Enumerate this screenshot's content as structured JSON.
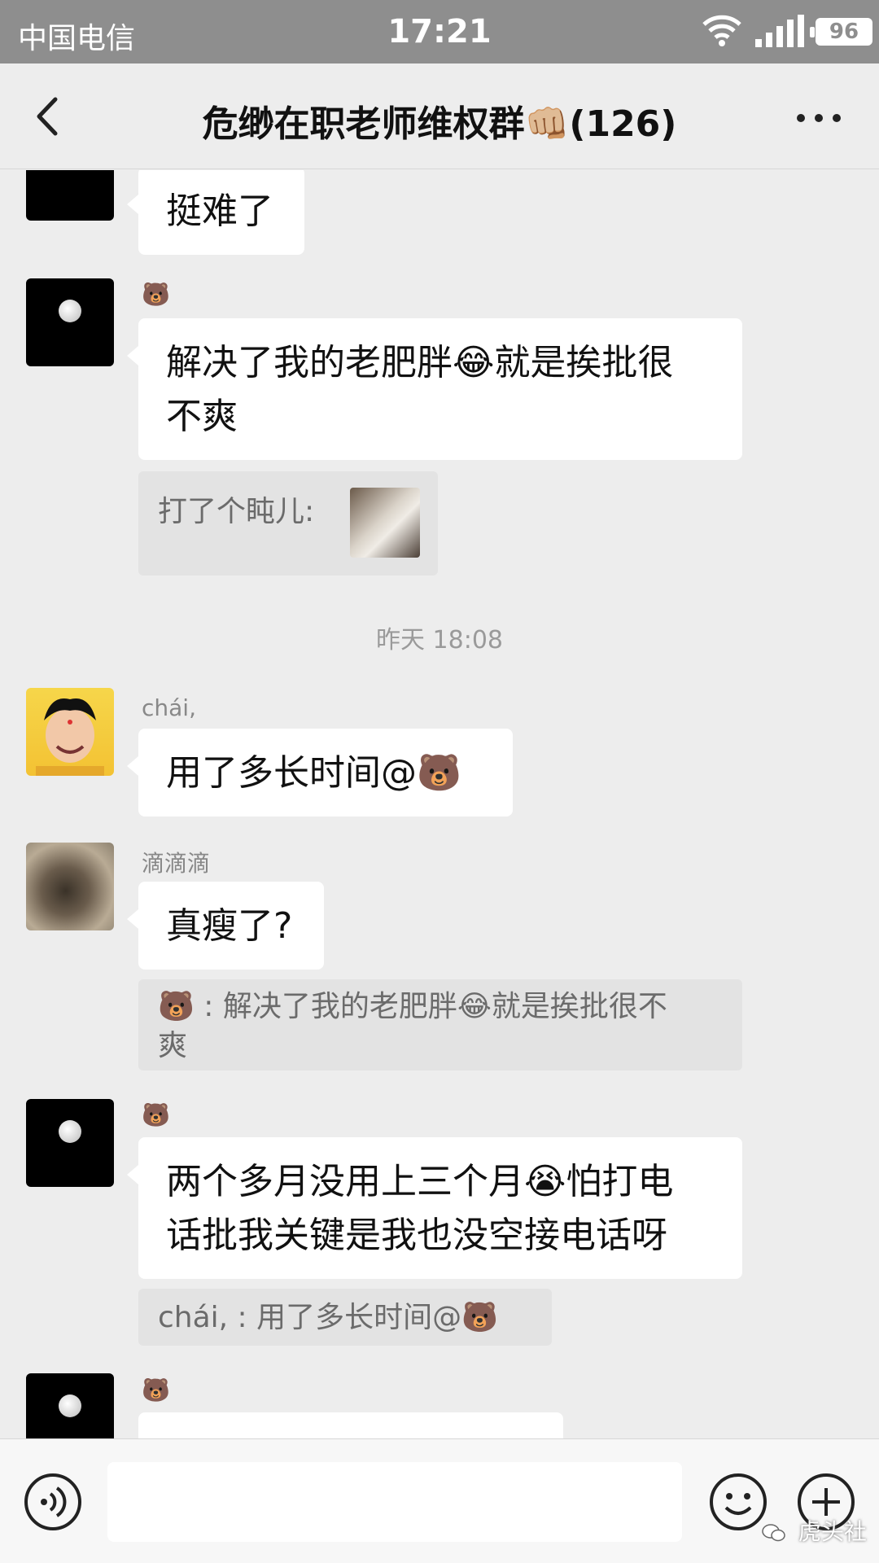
{
  "status_bar": {
    "carrier": "中国电信",
    "time": "17:21",
    "battery": "96"
  },
  "nav": {
    "title": "危缈在职老师维权群👊🏼(126)"
  },
  "messages": [
    {
      "text": "挺难了"
    },
    {
      "sender": "🐻",
      "text": "解决了我的老肥胖😂就是挨批很\n不爽",
      "quote": "打了个盹儿:"
    },
    {
      "sender": "chái,",
      "text": "用了多长时间@🐻"
    },
    {
      "sender": "滴滴滴",
      "text": "真瘦了?",
      "quote": "🐻 :  解决了我的老肥胖😂就是挨批很不\n爽"
    },
    {
      "sender": "🐻",
      "text": "两个多月没用上三个月😭怕打电\n话批我关键是我也没空接电话呀",
      "quote": "chái, :  用了多长时间@🐻"
    },
    {
      "sender": "🐻",
      "text": ""
    }
  ],
  "timestamp": "昨天 18:08",
  "input": {
    "placeholder": ""
  },
  "watermark": "虎头社",
  "colors": {
    "status_bg": "#8e8e8e",
    "chat_bg": "#ededed",
    "bubble": "#ffffff",
    "quote": "#e3e3e3"
  },
  "icons": [
    "back-chevron-icon",
    "more-dots-icon",
    "voice-icon",
    "emoji-icon",
    "plus-icon",
    "wifi-icon",
    "signal-icon"
  ]
}
